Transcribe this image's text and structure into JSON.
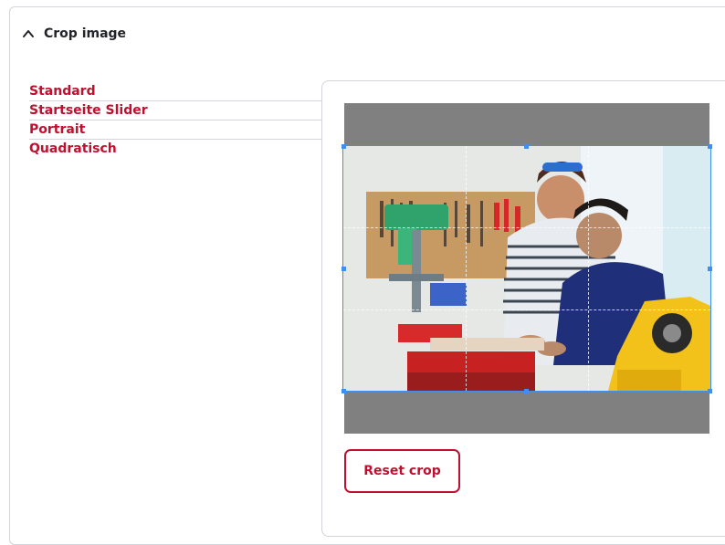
{
  "details": {
    "summary_label": "Crop image",
    "expanded": true
  },
  "tabs": [
    {
      "label": "Standard",
      "active": true
    },
    {
      "label": "Startseite Slider",
      "active": false
    },
    {
      "label": "Portrait",
      "active": false
    },
    {
      "label": "Quadratisch",
      "active": false
    }
  ],
  "cropper": {
    "reset_label": "Reset crop"
  },
  "colors": {
    "accent": "#c0102f",
    "crop_outline": "#3d8ff0",
    "canvas_background": "#808080"
  },
  "icons": {
    "summary": "chevron-up-icon"
  }
}
